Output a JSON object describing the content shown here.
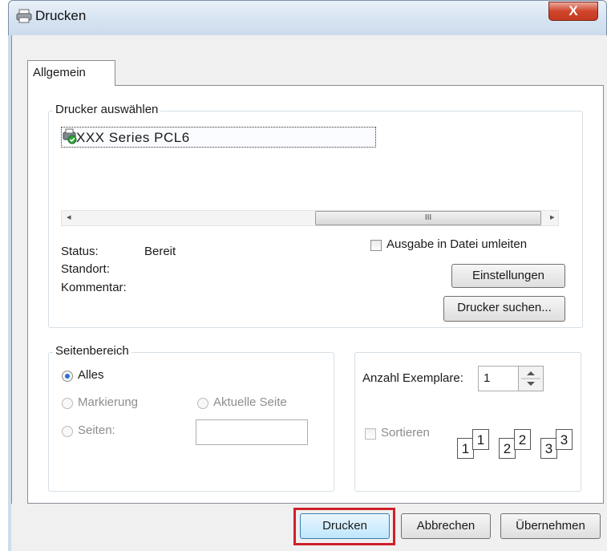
{
  "window": {
    "title": "Drucken",
    "close_label": "X"
  },
  "tabs": [
    {
      "label": "Allgemein"
    }
  ],
  "printer_group": {
    "legend": "Drucker auswählen",
    "printers": [
      {
        "name": "XXX Series PCL6"
      }
    ],
    "scroll_left": "◂",
    "scroll_right": "▸",
    "scroll_thumb": "III",
    "status_label": "Status:",
    "status_value": "Bereit",
    "location_label": "Standort:",
    "comment_label": "Kommentar:",
    "print_to_file_label": "Ausgabe in Datei umleiten",
    "settings_button": "Einstellungen",
    "find_printer_button": "Drucker suchen..."
  },
  "page_range": {
    "legend": "Seitenbereich",
    "all_label": "Alles",
    "selection_label": "Markierung",
    "current_page_label": "Aktuelle Seite",
    "pages_label": "Seiten:",
    "pages_value": ""
  },
  "copies": {
    "count_label": "Anzahl Exemplare:",
    "count_value": "1",
    "collate_label": "Sortieren",
    "page_numbers": [
      "1",
      "1",
      "2",
      "2",
      "3",
      "3"
    ]
  },
  "buttons": {
    "print": "Drucken",
    "cancel": "Abbrechen",
    "apply": "Übernehmen"
  },
  "colors": {
    "highlight_box": "#d0202a",
    "radio_selected": "#2a6fd6"
  }
}
